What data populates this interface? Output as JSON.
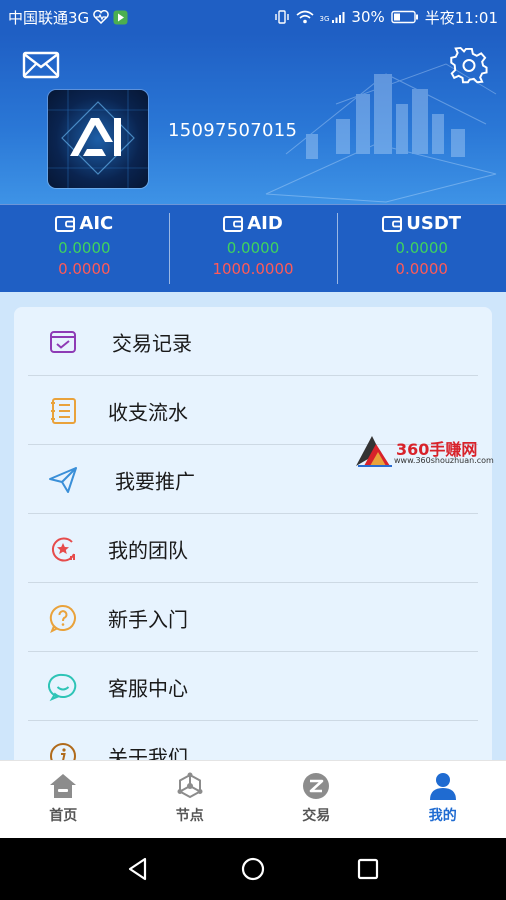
{
  "status_bar": {
    "carrier": "中国联通3G",
    "network_badge": "3G",
    "battery": "30%",
    "time": "半夜11:01",
    "icons": [
      "heart-pulse-icon",
      "play-store-icon",
      "vibrate-icon",
      "wifi-icon",
      "signal-icon",
      "battery-icon"
    ]
  },
  "header": {
    "mail_icon": "mail-icon",
    "settings_icon": "gear-icon",
    "avatar_text": "AI",
    "phone": "15097507015"
  },
  "balances": [
    {
      "name": "AIC",
      "green": "0.0000",
      "red": "0.0000"
    },
    {
      "name": "AID",
      "green": "0.0000",
      "red": "1000.0000"
    },
    {
      "name": "USDT",
      "green": "0.0000",
      "red": "0.0000"
    }
  ],
  "menu": [
    {
      "label": "交易记录",
      "icon": "wallet-check-icon",
      "color": "#8e3bb5"
    },
    {
      "label": "收支流水",
      "icon": "ledger-icon",
      "color": "#e9a23b"
    },
    {
      "label": "我要推广",
      "icon": "paper-plane-icon",
      "color": "#3a8fd8"
    },
    {
      "label": "我的团队",
      "icon": "team-star-icon",
      "color": "#e64b4b"
    },
    {
      "label": "新手入门",
      "icon": "question-bubble-icon",
      "color": "#e9a23b"
    },
    {
      "label": "客服中心",
      "icon": "chat-bubble-icon",
      "color": "#2ec4b6"
    },
    {
      "label": "关于我们",
      "icon": "info-icon",
      "color": "#b06a1b"
    }
  ],
  "watermark": {
    "title": "360手赚网",
    "url": "www.360shouzhuan.com"
  },
  "tabs": [
    {
      "label": "首页",
      "icon": "home-icon",
      "active": false
    },
    {
      "label": "节点",
      "icon": "node-icon",
      "active": false
    },
    {
      "label": "交易",
      "icon": "trade-icon",
      "active": false
    },
    {
      "label": "我的",
      "icon": "user-icon",
      "active": true
    }
  ],
  "nav": [
    "back-icon",
    "home-circle-icon",
    "recents-icon"
  ],
  "colors": {
    "primary": "#1f5fc4",
    "green": "#3fd35d",
    "red": "#ff5a57",
    "active_tab": "#1f6bd1"
  }
}
